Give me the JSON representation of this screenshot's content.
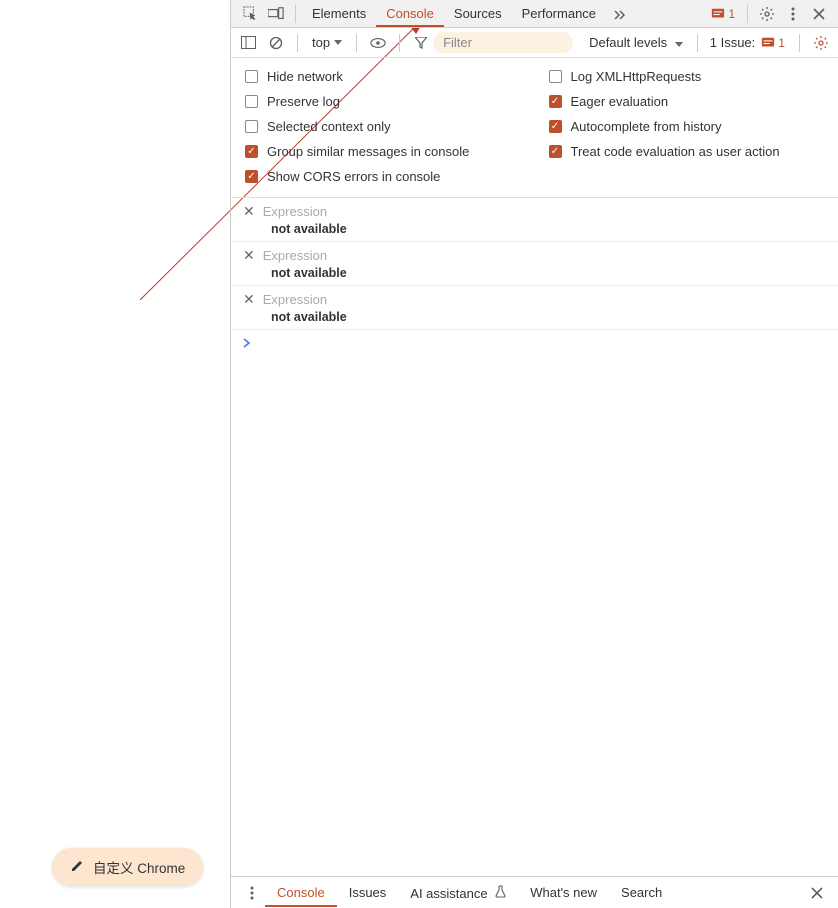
{
  "tabs": {
    "elements": "Elements",
    "console": "Console",
    "sources": "Sources",
    "performance": "Performance"
  },
  "top_badges": {
    "msg_count": "1",
    "issue_count": "1"
  },
  "toolbar": {
    "context": "top",
    "filter_placeholder": "Filter",
    "levels": "Default levels",
    "issues_label": "1 Issue:"
  },
  "settings": {
    "left": [
      {
        "label": "Hide network",
        "checked": false
      },
      {
        "label": "Preserve log",
        "checked": false
      },
      {
        "label": "Selected context only",
        "checked": false
      },
      {
        "label": "Group similar messages in console",
        "checked": true
      },
      {
        "label": "Show CORS errors in console",
        "checked": true
      }
    ],
    "right": [
      {
        "label": "Log XMLHttpRequests",
        "checked": false
      },
      {
        "label": "Eager evaluation",
        "checked": true
      },
      {
        "label": "Autocomplete from history",
        "checked": true
      },
      {
        "label": "Treat code evaluation as user action",
        "checked": true
      }
    ]
  },
  "expressions": [
    {
      "placeholder": "Expression",
      "value": "not available"
    },
    {
      "placeholder": "Expression",
      "value": "not available"
    },
    {
      "placeholder": "Expression",
      "value": "not available"
    }
  ],
  "drawer": {
    "console": "Console",
    "issues": "Issues",
    "ai": "AI assistance",
    "whatsnew": "What's new",
    "search": "Search"
  },
  "customize_btn": "自定义 Chrome"
}
